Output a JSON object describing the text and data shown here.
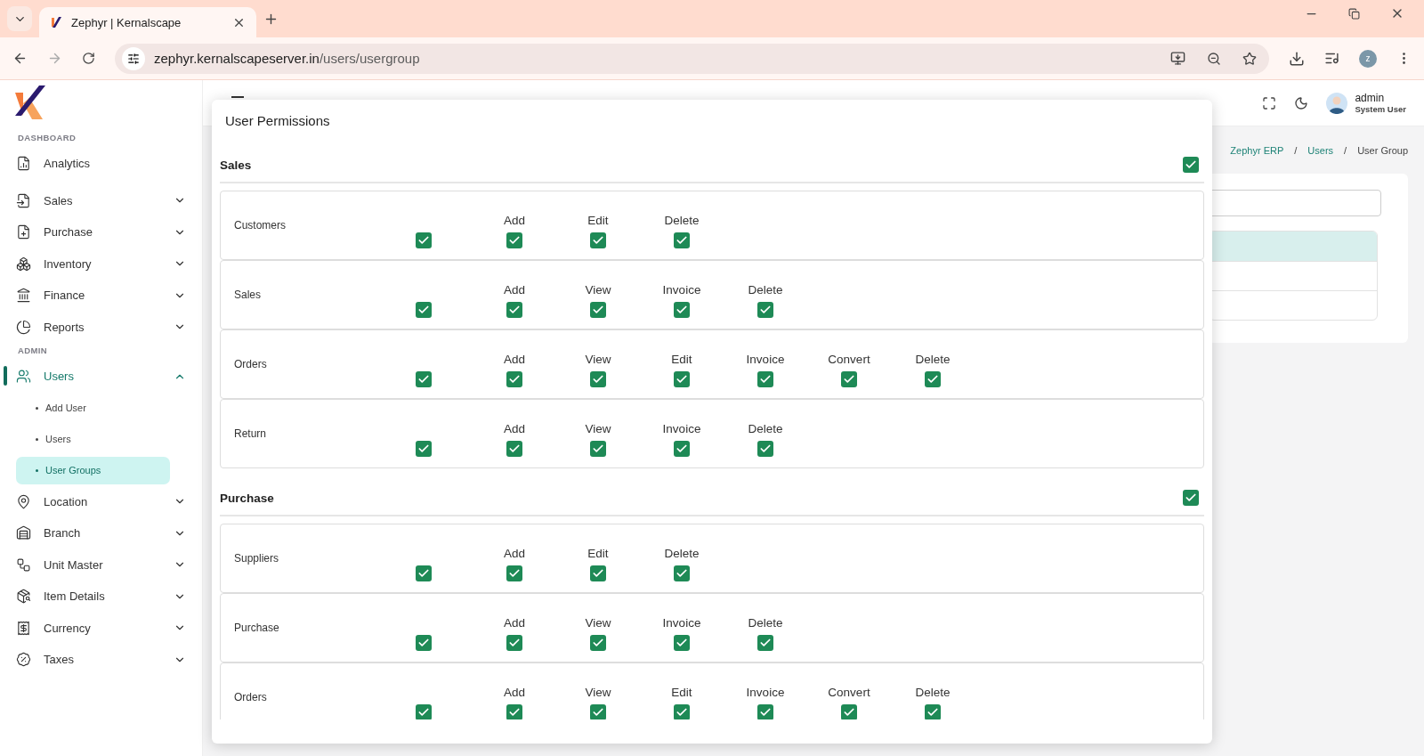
{
  "browser": {
    "tab_title": "Zephyr | Kernalscape",
    "url_host": "zephyr.kernalscapeserver.in",
    "url_path": "/users/usergroup",
    "profile_initial": "z"
  },
  "sidebar": {
    "sections": [
      {
        "heading": "DASHBOARD",
        "items": [
          {
            "kind": "link",
            "label": "Analytics",
            "selected": false
          },
          {
            "kind": "group",
            "label": "Sales",
            "selected": false,
            "expanded": false
          },
          {
            "kind": "group",
            "label": "Purchase",
            "selected": false,
            "expanded": false
          },
          {
            "kind": "group",
            "label": "Inventory",
            "selected": false,
            "expanded": false
          },
          {
            "kind": "group",
            "label": "Finance",
            "selected": false,
            "expanded": false
          },
          {
            "kind": "group",
            "label": "Reports",
            "selected": false,
            "expanded": false
          }
        ]
      },
      {
        "heading": "ADMIN",
        "items": [
          {
            "kind": "group",
            "label": "Users",
            "selected": true,
            "expanded": true,
            "children": [
              {
                "label": "Add User",
                "selected": false
              },
              {
                "label": "Users",
                "selected": false
              },
              {
                "label": "User Groups",
                "selected": true
              }
            ]
          },
          {
            "kind": "group",
            "label": "Location",
            "selected": false,
            "expanded": false
          },
          {
            "kind": "group",
            "label": "Branch",
            "selected": false,
            "expanded": false
          },
          {
            "kind": "group",
            "label": "Unit Master",
            "selected": false,
            "expanded": false
          },
          {
            "kind": "group",
            "label": "Item Details",
            "selected": false,
            "expanded": false
          },
          {
            "kind": "group",
            "label": "Currency",
            "selected": false,
            "expanded": false
          },
          {
            "kind": "group",
            "label": "Taxes",
            "selected": false,
            "expanded": false
          }
        ]
      }
    ]
  },
  "header": {
    "user_name": "admin",
    "user_role": "System User"
  },
  "breadcrumb": [
    {
      "kind": "link",
      "label": "Zephyr ERP",
      "selected": false
    },
    {
      "kind": "separator",
      "label": "/"
    },
    {
      "kind": "link",
      "label": "Users",
      "selected": false
    },
    {
      "kind": "separator",
      "label": "/"
    },
    {
      "kind": "link",
      "label": "User Group",
      "selected": true
    }
  ],
  "modal": {
    "title": "User Permissions",
    "sections": [
      {
        "title": "Sales",
        "checked": true,
        "rows": [
          {
            "label": "Customers",
            "checked": true,
            "permissions": [
              {
                "label": "Add",
                "checked": true
              },
              {
                "label": "Edit",
                "checked": true
              },
              {
                "label": "Delete",
                "checked": true
              }
            ]
          },
          {
            "label": "Sales",
            "checked": true,
            "permissions": [
              {
                "label": "Add",
                "checked": true
              },
              {
                "label": "View",
                "checked": true
              },
              {
                "label": "Invoice",
                "checked": true
              },
              {
                "label": "Delete",
                "checked": true
              }
            ]
          },
          {
            "label": "Orders",
            "checked": true,
            "permissions": [
              {
                "label": "Add",
                "checked": true
              },
              {
                "label": "View",
                "checked": true
              },
              {
                "label": "Edit",
                "checked": true
              },
              {
                "label": "Invoice",
                "checked": true
              },
              {
                "label": "Convert",
                "checked": true
              },
              {
                "label": "Delete",
                "checked": true
              }
            ]
          },
          {
            "label": "Return",
            "checked": true,
            "permissions": [
              {
                "label": "Add",
                "checked": true
              },
              {
                "label": "View",
                "checked": true
              },
              {
                "label": "Invoice",
                "checked": true
              },
              {
                "label": "Delete",
                "checked": true
              }
            ]
          }
        ]
      },
      {
        "title": "Purchase",
        "checked": true,
        "rows": [
          {
            "label": "Suppliers",
            "checked": true,
            "permissions": [
              {
                "label": "Add",
                "checked": true
              },
              {
                "label": "Edit",
                "checked": true
              },
              {
                "label": "Delete",
                "checked": true
              }
            ]
          },
          {
            "label": "Purchase",
            "checked": true,
            "permissions": [
              {
                "label": "Add",
                "checked": true
              },
              {
                "label": "View",
                "checked": true
              },
              {
                "label": "Invoice",
                "checked": true
              },
              {
                "label": "Delete",
                "checked": true
              }
            ]
          },
          {
            "label": "Orders",
            "checked": true,
            "permissions": [
              {
                "label": "Add",
                "checked": true
              },
              {
                "label": "View",
                "checked": true
              },
              {
                "label": "Edit",
                "checked": true
              },
              {
                "label": "Invoice",
                "checked": true
              },
              {
                "label": "Convert",
                "checked": true
              },
              {
                "label": "Delete",
                "checked": true
              }
            ]
          }
        ]
      }
    ]
  }
}
